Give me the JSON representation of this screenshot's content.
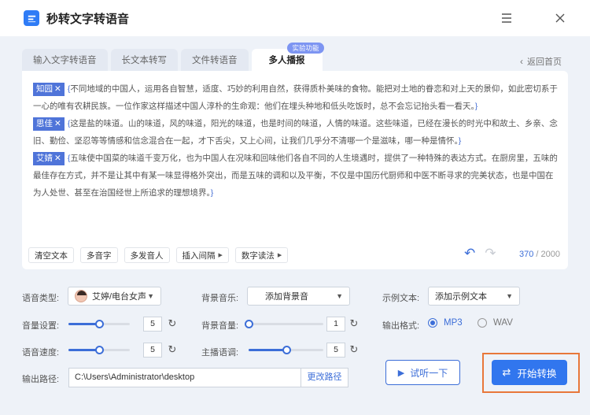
{
  "app": {
    "title": "秒转文字转语音"
  },
  "tabs": [
    {
      "label": "输入文字转语音"
    },
    {
      "label": "长文本转写"
    },
    {
      "label": "文件转语音"
    },
    {
      "label": "多人播报",
      "badge": "实验功能"
    }
  ],
  "back_label": "返回首页",
  "paragraphs": [
    {
      "speaker": "知园",
      "close": "✕",
      "open_brace": "{",
      "close_brace": "}",
      "text": "不同地域的中国人，运用各自智慧，适度、巧妙的利用自然，获得质朴美味的食物。能把对土地的眷恋和对上天的景仰，如此密切系于一心的唯有农耕民族。一位作家这样描述中国人淳朴的生命观：他们在埋头种地和低头吃饭时，总不会忘记抬头看一看天。"
    },
    {
      "speaker": "思佳",
      "close": "✕",
      "open_brace": "{",
      "close_brace": "}",
      "text": "这是盐的味道。山的味道，风的味道，阳光的味道，也是时间的味道，人情的味道。这些味道，已经在漫长的时光中和故土、乡亲、念旧、勤俭、坚忍等等情感和信念混合在一起，才下舌尖，又上心间，让我们几乎分不清哪一个是滋味，哪一种是情怀。"
    },
    {
      "speaker": "艾婧",
      "close": "✕",
      "open_brace": "{",
      "close_brace": "}",
      "text": "五味使中国菜的味道千变万化，也为中国人在况味和回味他们各自不同的人生境遇时，提供了一种特殊的表达方式。在厨房里，五味的最佳存在方式，并不是让其中有某一味显得格外突出，而是五味的调和以及平衡，不仅是中国历代厨师和中医不断寻求的完美状态，也是中国在为人处世、甚至在治国经世上所追求的理想境界。"
    }
  ],
  "toolbar": {
    "clear": "清空文本",
    "polyphone": "多音字",
    "multi_speaker": "多发音人",
    "insert_pause": "插入间隔",
    "digit_read": "数字读法",
    "arrow": "▶"
  },
  "counter": {
    "current": "370",
    "sep": " / ",
    "max": "2000"
  },
  "settings": {
    "voice_type_label": "语音类型:",
    "voice_type_value": "艾婷/电台女声",
    "bg_music_label": "背景音乐:",
    "bg_music_value": "添加背景音",
    "sample_text_label": "示例文本:",
    "sample_text_value": "添加示例文本",
    "volume_label": "音量设置:",
    "volume_value": "5",
    "volume_level": 0.5,
    "bg_volume_label": "背景音量:",
    "bg_volume_value": "1",
    "bg_volume_level": 0.0,
    "format_label": "输出格式:",
    "format_mp3": "MP3",
    "format_wav": "WAV",
    "speed_label": "语音速度:",
    "speed_value": "5",
    "speed_level": 0.5,
    "pitch_label": "主播语调:",
    "pitch_value": "5",
    "pitch_level": 0.5,
    "path_label": "输出路径:",
    "path_value": "C:\\Users\\Administrator\\desktop",
    "change_path": "更改路径"
  },
  "actions": {
    "preview": "试听一下",
    "convert": "开始转换"
  },
  "colors": {
    "accent": "#3176ee",
    "speaker_tag": "#4f74d9",
    "highlight_box": "#e8773a"
  }
}
